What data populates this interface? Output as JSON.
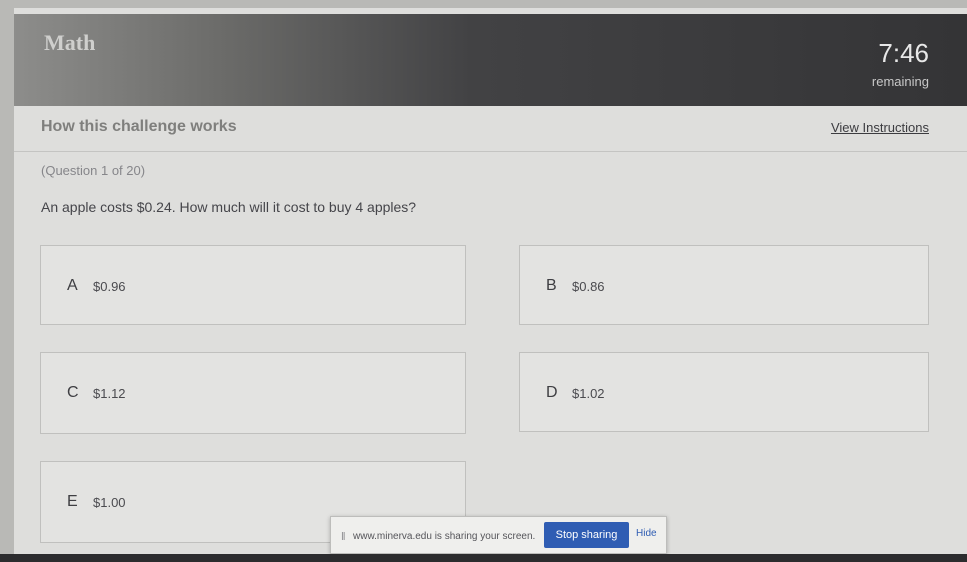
{
  "header": {
    "subject": "Math",
    "timer": "7:46",
    "timer_label": "remaining"
  },
  "challenge": {
    "title": "How this challenge works",
    "view_instructions": "View Instructions"
  },
  "question": {
    "number_text": "(Question 1 of 20)",
    "text": "An apple costs $0.24. How much will it cost to buy 4 apples?"
  },
  "options": [
    {
      "letter": "A",
      "value": "$0.96"
    },
    {
      "letter": "B",
      "value": "$0.86"
    },
    {
      "letter": "C",
      "value": "$1.12"
    },
    {
      "letter": "D",
      "value": "$1.02"
    },
    {
      "letter": "E",
      "value": "$1.00"
    }
  ],
  "share_bar": {
    "pause_icon": "pause-icon",
    "text": "www.minerva.edu is sharing your screen.",
    "stop_label": "Stop sharing",
    "hide_label": "Hide"
  },
  "colors": {
    "header_dark": "#343436",
    "stop_button": "#2f5db3"
  }
}
